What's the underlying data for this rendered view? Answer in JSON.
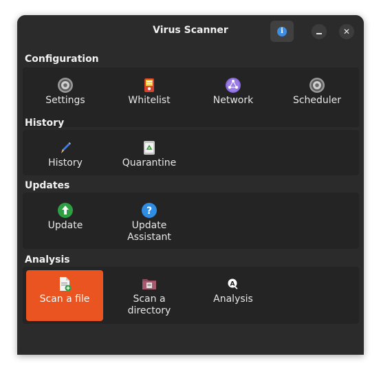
{
  "window": {
    "title": "Virus Scanner"
  },
  "sections": {
    "configuration": {
      "title": "Configuration",
      "items": [
        {
          "label": "Settings",
          "icon": "gear-icon"
        },
        {
          "label": "Whitelist",
          "icon": "whitelist-shield-icon"
        },
        {
          "label": "Network",
          "icon": "network-icon"
        },
        {
          "label": "Scheduler",
          "icon": "scheduler-gear-icon"
        }
      ]
    },
    "history": {
      "title": "History",
      "items": [
        {
          "label": "History",
          "icon": "pencil-icon"
        },
        {
          "label": "Quarantine",
          "icon": "recycle-bin-icon"
        }
      ]
    },
    "updates": {
      "title": "Updates",
      "items": [
        {
          "label": "Update",
          "icon": "update-arrow-icon"
        },
        {
          "label": "Update\nAssistant",
          "icon": "help-icon"
        }
      ]
    },
    "analysis": {
      "title": "Analysis",
      "items": [
        {
          "label": "Scan a file",
          "icon": "document-add-icon",
          "selected": true
        },
        {
          "label": "Scan a\ndirectory",
          "icon": "folder-icon"
        },
        {
          "label": "Analysis",
          "icon": "analysis-icon"
        }
      ]
    }
  },
  "colors": {
    "accent": "#e95420",
    "window_bg": "#2b2b2b",
    "panel_bg": "#242424"
  }
}
